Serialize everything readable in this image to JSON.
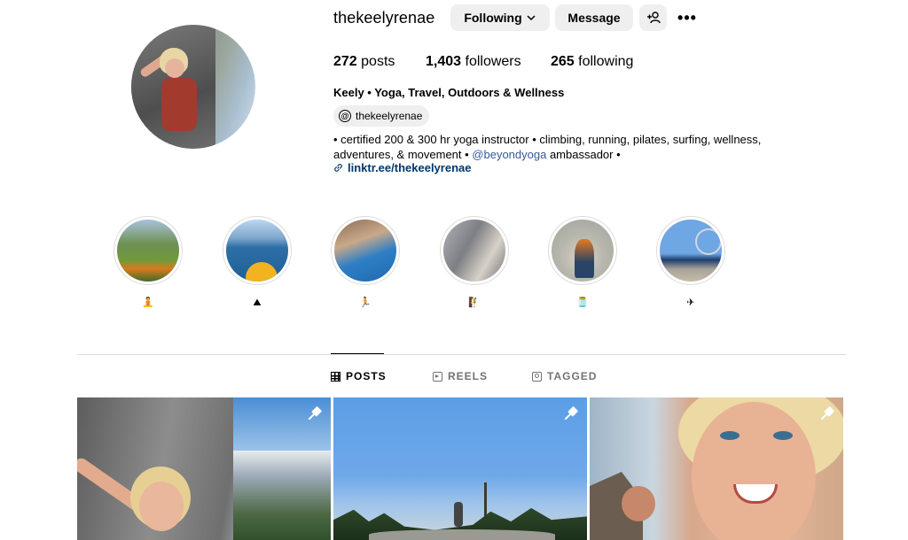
{
  "profile": {
    "username": "thekeelyrenae",
    "buttons": {
      "following": "Following",
      "message": "Message"
    },
    "stats": {
      "posts_count": "272",
      "posts_label": "posts",
      "followers_count": "1,403",
      "followers_label": "followers",
      "following_count": "265",
      "following_label": "following"
    },
    "full_name": "Keely • Yoga, Travel, Outdoors & Wellness",
    "threads_handle": "thekeelyrenae",
    "bio_part1": "• certified 200 & 300 hr yoga instructor • climbing, running, pilates, surfing, wellness, adventures, & movement • ",
    "bio_mention": "@beyondyoga",
    "bio_part2": " ambassador •",
    "link": "linktr.ee/thekeelyrenae"
  },
  "highlights": [
    {
      "label": "🧘",
      "icon": "yoga-emoji"
    },
    {
      "label": "⛰",
      "icon": "mountain-emoji"
    },
    {
      "label": "🏃",
      "icon": "runner-emoji"
    },
    {
      "label": "🧗",
      "icon": "climber-emoji"
    },
    {
      "label": "🫙",
      "icon": "jar-emoji"
    },
    {
      "label": "✈",
      "icon": "airplane-emoji"
    }
  ],
  "tabs": {
    "posts": "POSTS",
    "reels": "REELS",
    "tagged": "TAGGED"
  },
  "colors": {
    "link": "#00376b",
    "mention": "#385898",
    "button_bg": "#efefef",
    "divider": "#dbdbdb"
  }
}
